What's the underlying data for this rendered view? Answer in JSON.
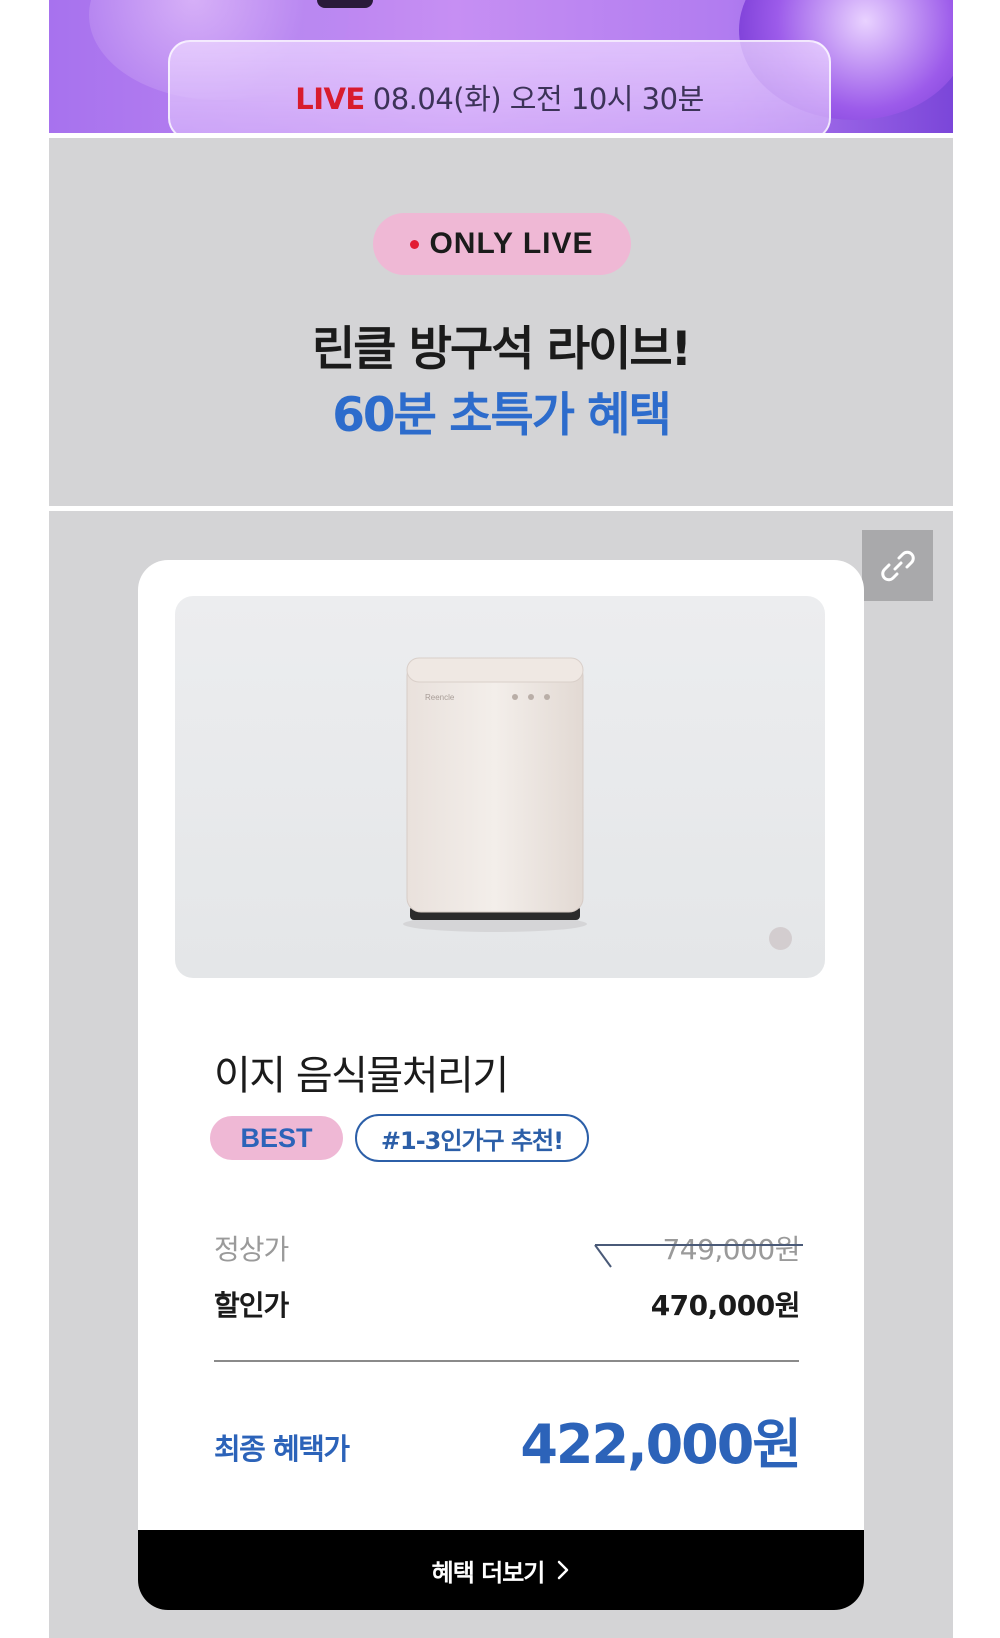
{
  "banner": {
    "live_label": "LIVE",
    "schedule": "08.04(화) 오전 10시 30분"
  },
  "headline": {
    "pill_label": "ONLY LIVE",
    "line1": "린클 방구석 라이브!",
    "line2": "60분 초특가 혜택"
  },
  "product": {
    "name": "이지 음식물처리기",
    "badge_best": "BEST",
    "badge_tag": "#1-3인가구 추천!",
    "regular_price_label": "정상가",
    "regular_price": "749,000원",
    "sale_price_label": "할인가",
    "sale_price": "470,000원",
    "final_price_label": "최종 혜택가",
    "final_price": "422,000원",
    "image_brand_text": "Reencle"
  },
  "actions": {
    "more_benefits": "혜택 더보기",
    "link_icon": "link-icon",
    "chevron_icon": "chevron-right-icon"
  },
  "colors": {
    "accent_blue": "#2c63b9",
    "live_red": "#d81b2d",
    "pill_pink": "#efb8d5",
    "section_gray": "#d4d4d6"
  }
}
